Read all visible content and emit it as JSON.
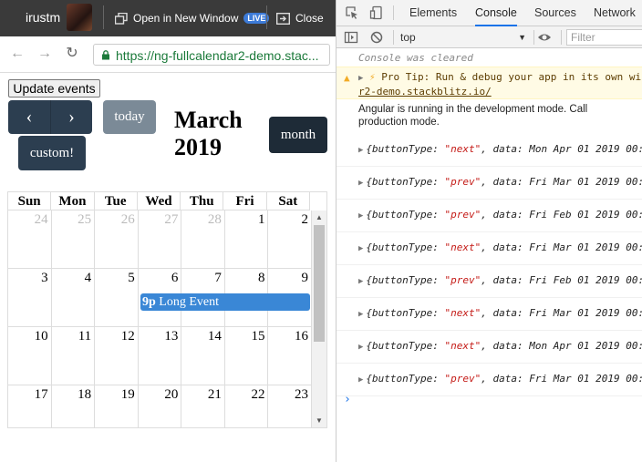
{
  "preview": {
    "user_name": "irustm",
    "open_new_window": "Open in New Window",
    "live_badge": "LIVE",
    "close": "Close",
    "url": "https://ng-fullcalendar2-demo.stac..."
  },
  "calendar": {
    "update_button": "Update events",
    "prev_label": "‹",
    "next_label": "›",
    "today_label": "today",
    "custom_label": "custom!",
    "month_label": "month",
    "title_line1": "March",
    "title_line2": "2019",
    "weekdays": [
      "Sun",
      "Mon",
      "Tue",
      "Wed",
      "Thu",
      "Fri",
      "Sat"
    ],
    "weeks": [
      [
        {
          "n": "24",
          "other": true
        },
        {
          "n": "25",
          "other": true
        },
        {
          "n": "26",
          "other": true
        },
        {
          "n": "27",
          "other": true
        },
        {
          "n": "28",
          "other": true
        },
        {
          "n": "1",
          "other": false
        },
        {
          "n": "2",
          "other": false
        }
      ],
      [
        {
          "n": "3",
          "other": false
        },
        {
          "n": "4",
          "other": false
        },
        {
          "n": "5",
          "other": false
        },
        {
          "n": "6",
          "other": false
        },
        {
          "n": "7",
          "other": false
        },
        {
          "n": "8",
          "other": false
        },
        {
          "n": "9",
          "other": false
        }
      ],
      [
        {
          "n": "10",
          "other": false
        },
        {
          "n": "11",
          "other": false
        },
        {
          "n": "12",
          "other": false
        },
        {
          "n": "13",
          "other": false
        },
        {
          "n": "14",
          "other": false
        },
        {
          "n": "15",
          "other": false
        },
        {
          "n": "16",
          "other": false
        }
      ],
      [
        {
          "n": "17",
          "other": false
        },
        {
          "n": "18",
          "other": false
        },
        {
          "n": "19",
          "other": false
        },
        {
          "n": "20",
          "other": false
        },
        {
          "n": "21",
          "other": false
        },
        {
          "n": "22",
          "other": false
        },
        {
          "n": "23",
          "other": false
        }
      ]
    ],
    "event": {
      "time": "9p",
      "title": "Long Event",
      "color": "#3a87d6"
    }
  },
  "devtools": {
    "tabs": [
      "Elements",
      "Console",
      "Sources",
      "Network"
    ],
    "active_tab": "Console",
    "context": "top",
    "filter_placeholder": "Filter",
    "cleared": "Console was cleared",
    "tip": "Pro Tip: Run & debug your app in its own wi",
    "tip_url": "r2-demo.stackblitz.io/",
    "angular_line1": "Angular is running in the development mode. Call",
    "angular_line2": "production mode.",
    "logs": [
      {
        "type": "next",
        "data": "Mon Apr 01 2019 00:"
      },
      {
        "type": "prev",
        "data": "Fri Mar 01 2019 00:"
      },
      {
        "type": "prev",
        "data": "Fri Feb 01 2019 00:"
      },
      {
        "type": "next",
        "data": "Fri Mar 01 2019 00:"
      },
      {
        "type": "prev",
        "data": "Fri Feb 01 2019 00:"
      },
      {
        "type": "next",
        "data": "Fri Mar 01 2019 00:"
      },
      {
        "type": "next",
        "data": "Mon Apr 01 2019 00:"
      },
      {
        "type": "prev",
        "data": "Fri Mar 01 2019 00:"
      }
    ],
    "log_prefix": "{buttonType: ",
    "log_mid": ", data: ",
    "prompt": "›"
  }
}
